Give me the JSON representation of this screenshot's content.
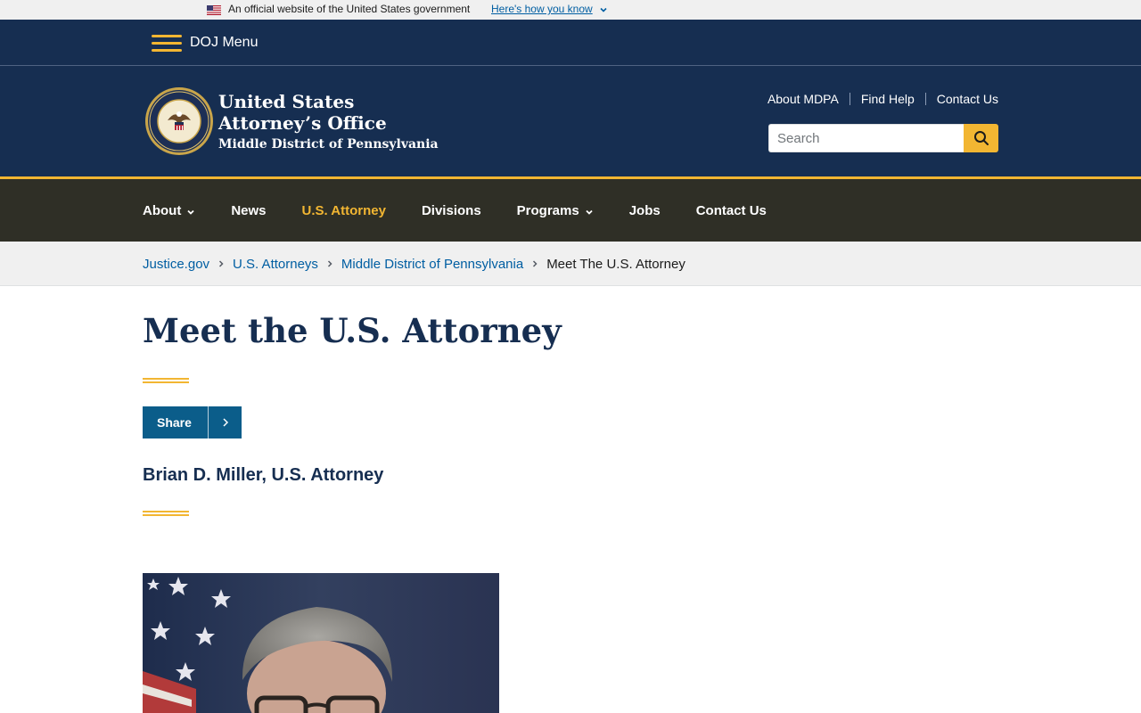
{
  "gov_banner": {
    "official_text": "An official website of the United States government",
    "how_link": "Here's how you know"
  },
  "doj_menu": {
    "label": "DOJ Menu"
  },
  "header": {
    "title_line1": "United States",
    "title_line2": "Attorney’s Office",
    "title_line3": "Middle District of Pennsylvania",
    "utility_links": [
      "About MDPA",
      "Find Help",
      "Contact Us"
    ],
    "search": {
      "placeholder": "Search",
      "value": ""
    }
  },
  "main_nav": {
    "items": [
      {
        "label": "About",
        "has_dropdown": true,
        "active": false
      },
      {
        "label": "News",
        "has_dropdown": false,
        "active": false
      },
      {
        "label": "U.S. Attorney",
        "has_dropdown": false,
        "active": true
      },
      {
        "label": "Divisions",
        "has_dropdown": false,
        "active": false
      },
      {
        "label": "Programs",
        "has_dropdown": true,
        "active": false
      },
      {
        "label": "Jobs",
        "has_dropdown": false,
        "active": false
      },
      {
        "label": "Contact Us",
        "has_dropdown": false,
        "active": false
      }
    ]
  },
  "breadcrumb": {
    "items": [
      "Justice.gov",
      "U.S. Attorneys",
      "Middle District of Pennsylvania"
    ],
    "current": "Meet The U.S. Attorney"
  },
  "content": {
    "page_title": "Meet the U.S. Attorney",
    "share_label": "Share",
    "attorney_name": "Brian D. Miller, U.S. Attorney"
  },
  "colors": {
    "navy": "#162e51",
    "gold": "#f2b632",
    "nav_bg": "#2f2f26",
    "link": "#005ea2",
    "share_bg": "#0b5d8a"
  }
}
